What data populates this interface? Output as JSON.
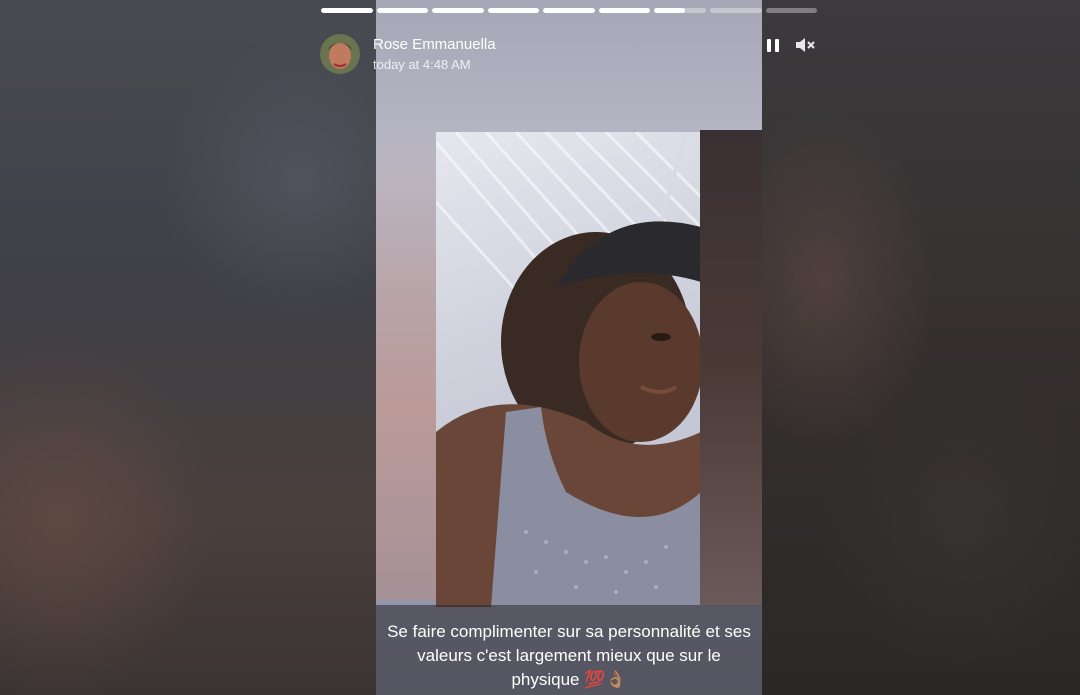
{
  "story": {
    "user_name": "Rose Emmanuella",
    "timestamp": "today at 4:48 AM",
    "caption_lines": [
      "Se faire complimenter sur sa personnalité et ses",
      "valeurs c'est largement mieux que sur le",
      "physique 💯👌🏽"
    ],
    "progress": {
      "total_segments": 9,
      "completed_segments": 6,
      "current_segment_fraction": 0.6
    }
  },
  "controls": {
    "pause_icon": "pause-icon",
    "mute_icon": "speaker-muted-icon"
  },
  "colors": {
    "segment_done": "#ffffff",
    "segment_pending": "rgba(255,255,255,0.35)",
    "caption_background": "rgba(40,40,45,0.55)"
  }
}
